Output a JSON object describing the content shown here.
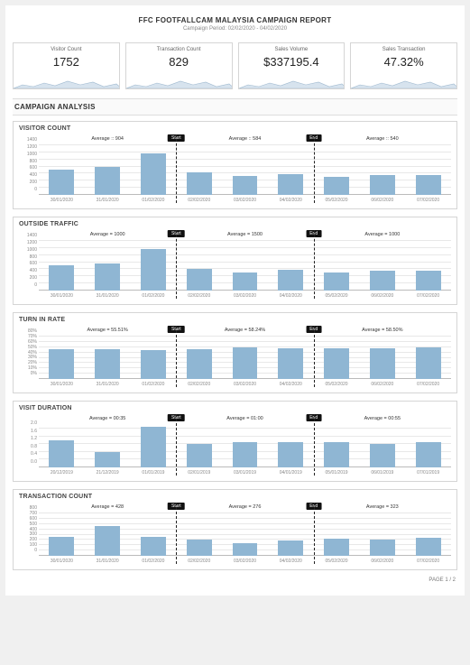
{
  "header": {
    "title": "FFC FOOTFALLCAM MALAYSIA CAMPAIGN REPORT",
    "period": "Campaign Period: 02/02/2020 - 04/02/2020"
  },
  "kpis": [
    {
      "label": "Visitor Count",
      "value": "1752"
    },
    {
      "label": "Transaction Count",
      "value": "829"
    },
    {
      "label": "Sales Volume",
      "value": "$337195.4"
    },
    {
      "label": "Sales Transaction",
      "value": "47.32%"
    }
  ],
  "section_label": "CAMPAIGN ANALYSIS",
  "footer": "PAGE 1 / 2",
  "band_labels": {
    "start": "Start",
    "end": "End"
  },
  "charts": [
    {
      "title": "VISITOR COUNT",
      "labels": [
        "30/01/2020",
        "31/01/2020",
        "01/02/2020",
        "02/02/2020",
        "03/02/2020",
        "04/02/2020",
        "05/02/2020",
        "06/02/2020",
        "07/02/2020"
      ],
      "values": [
        720,
        800,
        1180,
        630,
        530,
        590,
        500,
        560,
        560
      ],
      "ymax": 1400,
      "ystep": 200,
      "ysuffix": "",
      "averages": [
        "Average :: 904",
        "Average :: 584",
        "Average :: 540"
      ],
      "tall": true
    },
    {
      "title": "OUTSIDE TRAFFIC",
      "labels": [
        "30/01/2020",
        "31/01/2020",
        "01/02/2020",
        "02/02/2020",
        "03/02/2020",
        "04/02/2020",
        "05/02/2020",
        "06/02/2020",
        "07/02/2020"
      ],
      "values": [
        720,
        760,
        1170,
        610,
        520,
        580,
        500,
        560,
        560
      ],
      "ymax": 1400,
      "ystep": 200,
      "ysuffix": "",
      "averages": [
        "Average = 1000",
        "Average = 1500",
        "Average = 1000"
      ],
      "tall": true
    },
    {
      "title": "TURN IN RATE",
      "labels": [
        "30/01/2020",
        "31/01/2020",
        "01/02/2020",
        "02/02/2020",
        "03/02/2020",
        "04/02/2020",
        "05/02/2020",
        "06/02/2020",
        "07/02/2020"
      ],
      "values": [
        56,
        56,
        55,
        57,
        59,
        58,
        58,
        58,
        60
      ],
      "ymax": 80,
      "ystep": 10,
      "ysuffix": "%",
      "averages": [
        "Average = 55.51%",
        "Average = 58.24%",
        "Average = 58.50%"
      ],
      "tall": false
    },
    {
      "title": "VISIT DURATION",
      "labels": [
        "20/12/2019",
        "21/12/2019",
        "01/01/2019",
        "02/01/2019",
        "03/01/2019",
        "04/01/2019",
        "05/01/2019",
        "06/01/2019",
        "07/01/2019"
      ],
      "values": [
        1.4,
        0.8,
        2.1,
        1.2,
        1.3,
        1.3,
        1.3,
        1.2,
        1.3
      ],
      "ymax": 2.2,
      "ystep": 0.4,
      "ysuffix": "",
      "averages": [
        "Average = 00:35",
        "Average = 01:00",
        "Average = 00:55"
      ],
      "tall": false
    },
    {
      "title": "TRANSACTION COUNT",
      "labels": [
        "30/01/2020",
        "31/01/2020",
        "01/02/2020",
        "02/02/2020",
        "03/02/2020",
        "04/02/2020",
        "05/02/2020",
        "06/02/2020",
        "07/02/2020"
      ],
      "values": [
        360,
        570,
        350,
        300,
        240,
        290,
        320,
        310,
        340
      ],
      "ymax": 800,
      "ystep": 100,
      "ysuffix": "",
      "averages": [
        "Average = 428",
        "Average = 276",
        "Average = 323"
      ],
      "tall": false
    }
  ],
  "chart_data": [
    {
      "type": "bar",
      "title": "VISITOR COUNT",
      "categories": [
        "30/01/2020",
        "31/01/2020",
        "01/02/2020",
        "02/02/2020",
        "03/02/2020",
        "04/02/2020",
        "05/02/2020",
        "06/02/2020",
        "07/02/2020"
      ],
      "values": [
        720,
        800,
        1180,
        630,
        530,
        590,
        500,
        560,
        560
      ],
      "ylim": [
        0,
        1400
      ],
      "annotations": [
        "Average :: 904",
        "Average :: 584",
        "Average :: 540"
      ],
      "markers": {
        "Start": 2.5,
        "End": 5.5
      }
    },
    {
      "type": "bar",
      "title": "OUTSIDE TRAFFIC",
      "categories": [
        "30/01/2020",
        "31/01/2020",
        "01/02/2020",
        "02/02/2020",
        "03/02/2020",
        "04/02/2020",
        "05/02/2020",
        "06/02/2020",
        "07/02/2020"
      ],
      "values": [
        720,
        760,
        1170,
        610,
        520,
        580,
        500,
        560,
        560
      ],
      "ylim": [
        0,
        1400
      ],
      "annotations": [
        "Average = 1000",
        "Average = 1500",
        "Average = 1000"
      ],
      "markers": {
        "Start": 2.5,
        "End": 5.5
      }
    },
    {
      "type": "bar",
      "title": "TURN IN RATE",
      "categories": [
        "30/01/2020",
        "31/01/2020",
        "01/02/2020",
        "02/02/2020",
        "03/02/2020",
        "04/02/2020",
        "05/02/2020",
        "06/02/2020",
        "07/02/2020"
      ],
      "values": [
        56,
        56,
        55,
        57,
        59,
        58,
        58,
        58,
        60
      ],
      "ylim": [
        0,
        80
      ],
      "ysuffix": "%",
      "annotations": [
        "Average = 55.51%",
        "Average = 58.24%",
        "Average = 58.50%"
      ],
      "markers": {
        "Start": 2.5,
        "End": 5.5
      }
    },
    {
      "type": "bar",
      "title": "VISIT DURATION",
      "categories": [
        "20/12/2019",
        "21/12/2019",
        "01/01/2019",
        "02/01/2019",
        "03/01/2019",
        "04/01/2019",
        "05/01/2019",
        "06/01/2019",
        "07/01/2019"
      ],
      "values": [
        1.4,
        0.8,
        2.1,
        1.2,
        1.3,
        1.3,
        1.3,
        1.2,
        1.3
      ],
      "ylim": [
        0,
        2.2
      ],
      "annotations": [
        "Average = 00:35",
        "Average = 01:00",
        "Average = 00:55"
      ],
      "markers": {
        "Start": 2.5,
        "End": 5.5
      }
    },
    {
      "type": "bar",
      "title": "TRANSACTION COUNT",
      "categories": [
        "30/01/2020",
        "31/01/2020",
        "01/02/2020",
        "02/02/2020",
        "03/02/2020",
        "04/02/2020",
        "05/02/2020",
        "06/02/2020",
        "07/02/2020"
      ],
      "values": [
        360,
        570,
        350,
        300,
        240,
        290,
        320,
        310,
        340
      ],
      "ylim": [
        0,
        800
      ],
      "annotations": [
        "Average = 428",
        "Average = 276",
        "Average = 323"
      ],
      "markers": {
        "Start": 2.5,
        "End": 5.5
      }
    }
  ]
}
